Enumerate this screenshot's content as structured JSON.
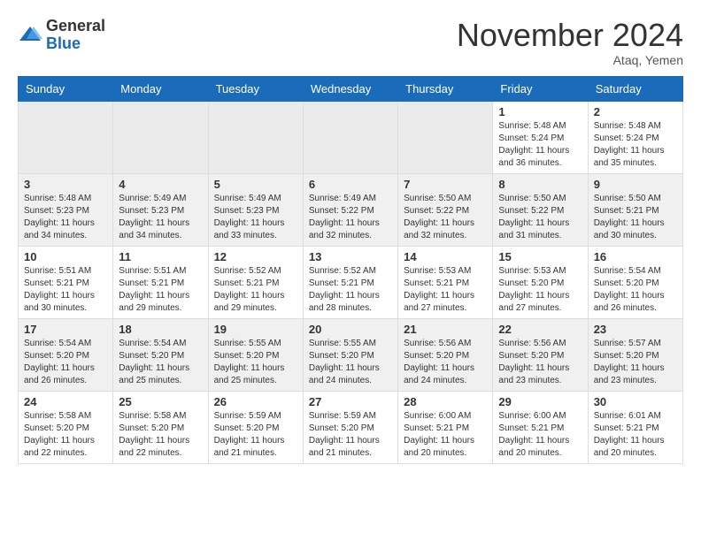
{
  "header": {
    "logo_general": "General",
    "logo_blue": "Blue",
    "month_title": "November 2024",
    "location": "Ataq, Yemen"
  },
  "weekdays": [
    "Sunday",
    "Monday",
    "Tuesday",
    "Wednesday",
    "Thursday",
    "Friday",
    "Saturday"
  ],
  "weeks": [
    [
      {
        "day": "",
        "info": ""
      },
      {
        "day": "",
        "info": ""
      },
      {
        "day": "",
        "info": ""
      },
      {
        "day": "",
        "info": ""
      },
      {
        "day": "",
        "info": ""
      },
      {
        "day": "1",
        "info": "Sunrise: 5:48 AM\nSunset: 5:24 PM\nDaylight: 11 hours\nand 36 minutes."
      },
      {
        "day": "2",
        "info": "Sunrise: 5:48 AM\nSunset: 5:24 PM\nDaylight: 11 hours\nand 35 minutes."
      }
    ],
    [
      {
        "day": "3",
        "info": "Sunrise: 5:48 AM\nSunset: 5:23 PM\nDaylight: 11 hours\nand 34 minutes."
      },
      {
        "day": "4",
        "info": "Sunrise: 5:49 AM\nSunset: 5:23 PM\nDaylight: 11 hours\nand 34 minutes."
      },
      {
        "day": "5",
        "info": "Sunrise: 5:49 AM\nSunset: 5:23 PM\nDaylight: 11 hours\nand 33 minutes."
      },
      {
        "day": "6",
        "info": "Sunrise: 5:49 AM\nSunset: 5:22 PM\nDaylight: 11 hours\nand 32 minutes."
      },
      {
        "day": "7",
        "info": "Sunrise: 5:50 AM\nSunset: 5:22 PM\nDaylight: 11 hours\nand 32 minutes."
      },
      {
        "day": "8",
        "info": "Sunrise: 5:50 AM\nSunset: 5:22 PM\nDaylight: 11 hours\nand 31 minutes."
      },
      {
        "day": "9",
        "info": "Sunrise: 5:50 AM\nSunset: 5:21 PM\nDaylight: 11 hours\nand 30 minutes."
      }
    ],
    [
      {
        "day": "10",
        "info": "Sunrise: 5:51 AM\nSunset: 5:21 PM\nDaylight: 11 hours\nand 30 minutes."
      },
      {
        "day": "11",
        "info": "Sunrise: 5:51 AM\nSunset: 5:21 PM\nDaylight: 11 hours\nand 29 minutes."
      },
      {
        "day": "12",
        "info": "Sunrise: 5:52 AM\nSunset: 5:21 PM\nDaylight: 11 hours\nand 29 minutes."
      },
      {
        "day": "13",
        "info": "Sunrise: 5:52 AM\nSunset: 5:21 PM\nDaylight: 11 hours\nand 28 minutes."
      },
      {
        "day": "14",
        "info": "Sunrise: 5:53 AM\nSunset: 5:21 PM\nDaylight: 11 hours\nand 27 minutes."
      },
      {
        "day": "15",
        "info": "Sunrise: 5:53 AM\nSunset: 5:20 PM\nDaylight: 11 hours\nand 27 minutes."
      },
      {
        "day": "16",
        "info": "Sunrise: 5:54 AM\nSunset: 5:20 PM\nDaylight: 11 hours\nand 26 minutes."
      }
    ],
    [
      {
        "day": "17",
        "info": "Sunrise: 5:54 AM\nSunset: 5:20 PM\nDaylight: 11 hours\nand 26 minutes."
      },
      {
        "day": "18",
        "info": "Sunrise: 5:54 AM\nSunset: 5:20 PM\nDaylight: 11 hours\nand 25 minutes."
      },
      {
        "day": "19",
        "info": "Sunrise: 5:55 AM\nSunset: 5:20 PM\nDaylight: 11 hours\nand 25 minutes."
      },
      {
        "day": "20",
        "info": "Sunrise: 5:55 AM\nSunset: 5:20 PM\nDaylight: 11 hours\nand 24 minutes."
      },
      {
        "day": "21",
        "info": "Sunrise: 5:56 AM\nSunset: 5:20 PM\nDaylight: 11 hours\nand 24 minutes."
      },
      {
        "day": "22",
        "info": "Sunrise: 5:56 AM\nSunset: 5:20 PM\nDaylight: 11 hours\nand 23 minutes."
      },
      {
        "day": "23",
        "info": "Sunrise: 5:57 AM\nSunset: 5:20 PM\nDaylight: 11 hours\nand 23 minutes."
      }
    ],
    [
      {
        "day": "24",
        "info": "Sunrise: 5:58 AM\nSunset: 5:20 PM\nDaylight: 11 hours\nand 22 minutes."
      },
      {
        "day": "25",
        "info": "Sunrise: 5:58 AM\nSunset: 5:20 PM\nDaylight: 11 hours\nand 22 minutes."
      },
      {
        "day": "26",
        "info": "Sunrise: 5:59 AM\nSunset: 5:20 PM\nDaylight: 11 hours\nand 21 minutes."
      },
      {
        "day": "27",
        "info": "Sunrise: 5:59 AM\nSunset: 5:20 PM\nDaylight: 11 hours\nand 21 minutes."
      },
      {
        "day": "28",
        "info": "Sunrise: 6:00 AM\nSunset: 5:21 PM\nDaylight: 11 hours\nand 20 minutes."
      },
      {
        "day": "29",
        "info": "Sunrise: 6:00 AM\nSunset: 5:21 PM\nDaylight: 11 hours\nand 20 minutes."
      },
      {
        "day": "30",
        "info": "Sunrise: 6:01 AM\nSunset: 5:21 PM\nDaylight: 11 hours\nand 20 minutes."
      }
    ]
  ]
}
